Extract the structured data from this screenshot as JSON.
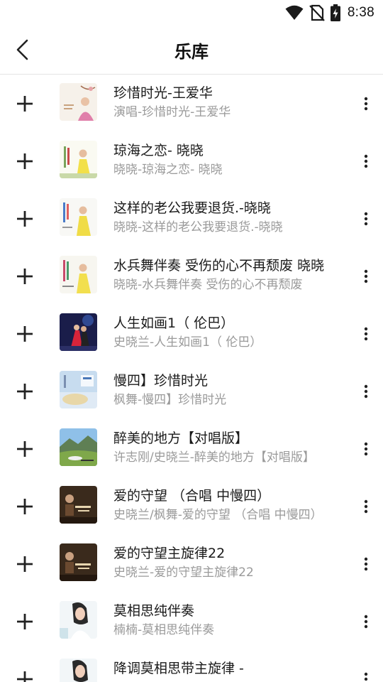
{
  "status_bar": {
    "time": "8:38",
    "icons": [
      "wifi-icon",
      "no-sim-icon",
      "battery-charging-icon"
    ]
  },
  "header": {
    "title": "乐库",
    "back_icon": "chevron-left-icon"
  },
  "songs": [
    {
      "title": "珍惜时光-王爱华",
      "subtitle": "演唱-珍惜时光-王爱华"
    },
    {
      "title": "琼海之恋- 晓晓",
      "subtitle": "晓晓-琼海之恋- 晓晓"
    },
    {
      "title": "这样的老公我要退货.-晓晓",
      "subtitle": "晓晓-这样的老公我要退货.-晓晓"
    },
    {
      "title": "水兵舞伴奏 受伤的心不再颓废 晓晓",
      "subtitle": "晓晓-水兵舞伴奏 受伤的心不再颓废"
    },
    {
      "title": "人生如画1（ 伦巴）",
      "subtitle": "史晓兰-人生如画1（ 伦巴）"
    },
    {
      "title": "慢四】珍惜时光",
      "subtitle": "枫舞-慢四】珍惜时光"
    },
    {
      "title": "醉美的地方【对唱版】",
      "subtitle": "许志刚/史晓兰-醉美的地方【对唱版】"
    },
    {
      "title": "爱的守望 （合唱 中慢四）",
      "subtitle": "史晓兰/枫舞-爱的守望 （合唱 中慢四）"
    },
    {
      "title": "爱的守望主旋律22",
      "subtitle": "史晓兰-爱的守望主旋律22"
    },
    {
      "title": "莫相思纯伴奏",
      "subtitle": "楠楠-莫相思纯伴奏"
    },
    {
      "title": "降调莫相思带主旋律 -",
      "subtitle": ""
    }
  ],
  "colors": {
    "title_text": "#1a1a1a",
    "subtitle_text": "#9a9a9a",
    "divider": "#e4e4e4"
  }
}
